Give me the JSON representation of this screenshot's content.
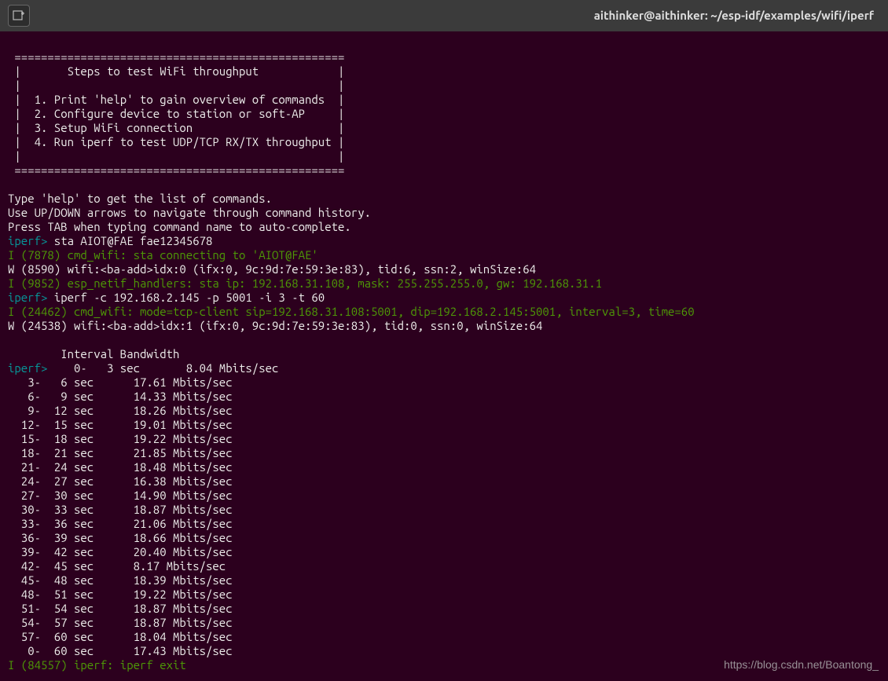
{
  "titlebar": {
    "icon": "terminal-new-tab-icon",
    "title": "aithinker@aithinker: ~/esp-idf/examples/wifi/iperf"
  },
  "banner": {
    "border_top": " ==================================================",
    "line_blank1": " |       Steps to test WiFi throughput            |",
    "line_blank2": " |                                                |",
    "step1": " |  1. Print 'help' to gain overview of commands  |",
    "step2": " |  2. Configure device to station or soft-AP     |",
    "step3": " |  3. Setup WiFi connection                      |",
    "step4": " |  4. Run iperf to test UDP/TCP RX/TX throughput |",
    "line_blank3": " |                                                |",
    "border_bottom": " =================================================="
  },
  "help": {
    "l1": "Type 'help' to get the list of commands.",
    "l2": "Use UP/DOWN arrows to navigate through command history.",
    "l3": "Press TAB when typing command name to auto-complete."
  },
  "prompt": "iperf>",
  "cmd_sta": " sta AIOT@FAE fae12345678",
  "sta_connect": "I (7878) cmd_wifi: sta connecting to 'AIOT@FAE'",
  "ba_add0": "W (8590) wifi:<ba-add>idx:0 (ifx:0, 9c:9d:7e:59:3e:83), tid:6, ssn:2, winSize:64",
  "netif": "I (9852) esp_netif_handlers: sta ip: 192.168.31.108, mask: 255.255.255.0, gw: 192.168.31.1",
  "cmd_iperf": " iperf -c 192.168.2.145 -p 5001 -i 3 -t 60",
  "cmd_wifi_mode": "I (24462) cmd_wifi: mode=tcp-client sip=192.168.31.108:5001, dip=192.168.2.145:5001, interval=3, time=60",
  "ba_add1": "W (24538) wifi:<ba-add>idx:1 (ifx:0, 9c:9d:7e:59:3e:83), tid:0, ssn:0, winSize:64",
  "header_interval": "        Interval Bandwidth",
  "first_result": "    0-   3 sec       8.04 Mbits/sec",
  "results": [
    "   3-   6 sec      17.61 Mbits/sec",
    "   6-   9 sec      14.33 Mbits/sec",
    "   9-  12 sec      18.26 Mbits/sec",
    "  12-  15 sec      19.01 Mbits/sec",
    "  15-  18 sec      19.22 Mbits/sec",
    "  18-  21 sec      21.85 Mbits/sec",
    "  21-  24 sec      18.48 Mbits/sec",
    "  24-  27 sec      16.38 Mbits/sec",
    "  27-  30 sec      14.90 Mbits/sec",
    "  30-  33 sec      18.87 Mbits/sec",
    "  33-  36 sec      21.06 Mbits/sec",
    "  36-  39 sec      18.66 Mbits/sec",
    "  39-  42 sec      20.40 Mbits/sec",
    "  42-  45 sec      8.17 Mbits/sec",
    "  45-  48 sec      18.39 Mbits/sec",
    "  48-  51 sec      19.22 Mbits/sec",
    "  51-  54 sec      18.87 Mbits/sec",
    "  54-  57 sec      18.87 Mbits/sec",
    "  57-  60 sec      18.04 Mbits/sec",
    "   0-  60 sec      17.43 Mbits/sec"
  ],
  "iperf_exit": "I (84557) iperf: iperf exit",
  "watermark": "https://blog.csdn.net/Boantong_"
}
